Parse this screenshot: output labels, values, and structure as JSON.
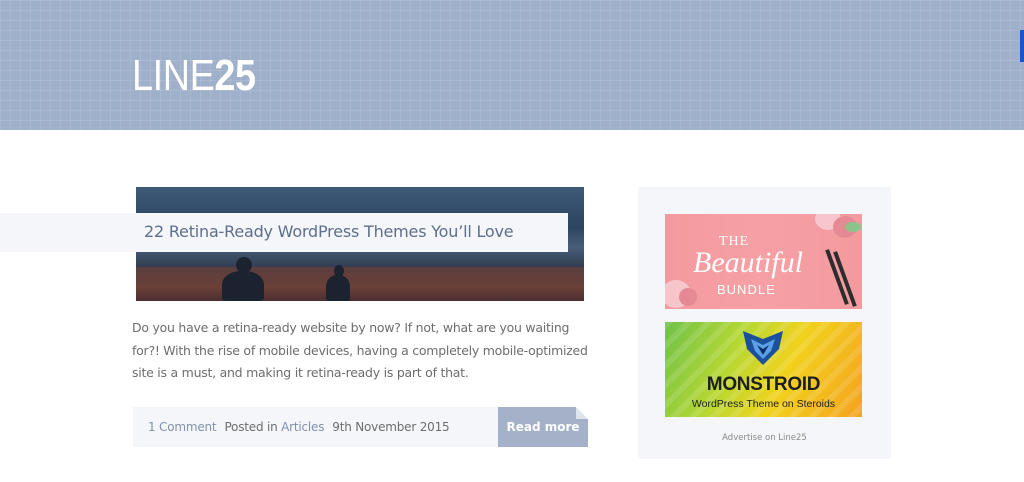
{
  "header": {
    "logo_light": "LINE",
    "logo_bold": "25",
    "background_color": "#9fb0ca"
  },
  "post": {
    "title": "22 Retina-Ready WordPress Themes You’ll Love",
    "excerpt": "Do you have a retina-ready website by now? If not, what are you waiting for?! With the rise of mobile devices, having a completely mobile-optimized site is a must, and making it retina-ready is part of that.",
    "comments": "1 Comment",
    "posted_in_label": "Posted in",
    "category": "Articles",
    "date": "9th November 2015",
    "read_more": "Read more"
  },
  "sidebar": {
    "ad1": {
      "line1": "THE",
      "line2": "Beautiful",
      "line3": "BUNDLE"
    },
    "ad2": {
      "title": "MONSTROID",
      "subtitle": "WordPress Theme on Steroids"
    },
    "advertise_link": "Advertise on Line25"
  },
  "colors": {
    "accent": "#a4b1c8",
    "link": "#8192ad",
    "panel": "#f4f6f9"
  }
}
